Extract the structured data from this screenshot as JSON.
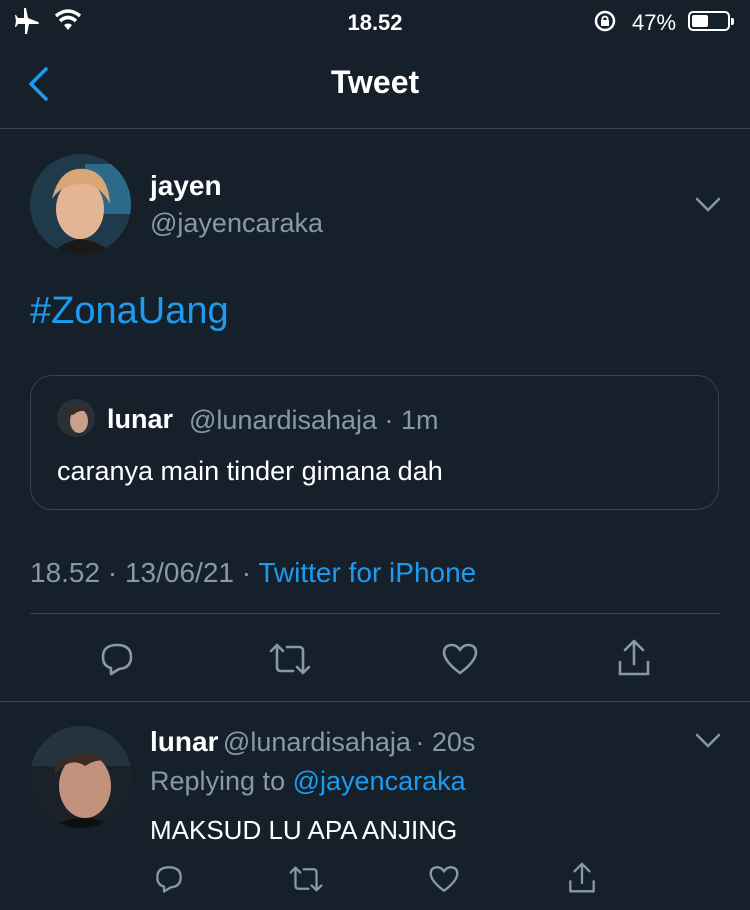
{
  "status_bar": {
    "time": "18.52",
    "battery_percent": "47%",
    "battery_level": 0.47
  },
  "nav": {
    "title": "Tweet",
    "back_icon": "chevron-left-icon"
  },
  "tweet": {
    "author_name": "jayen",
    "author_handle": "@jayencaraka",
    "text": "#ZonaUang",
    "quoted": {
      "name": "lunar",
      "handle": "@lunardisahaja",
      "time": "· 1m",
      "text": "caranya main tinder gimana dah"
    },
    "time": "18.52",
    "date": "13/06/21",
    "separator": "·",
    "source": "Twitter for iPhone"
  },
  "reply": {
    "author_name": "lunar",
    "author_handle": "@lunardisahaja",
    "time": "· 20s",
    "replying_label": "Replying to",
    "replying_handle": "@jayencaraka",
    "text": "MAKSUD LU APA ANJING"
  },
  "colors": {
    "background": "#15202b",
    "accent": "#1d9bf0",
    "muted": "#8899a6",
    "divider": "#38444d"
  }
}
